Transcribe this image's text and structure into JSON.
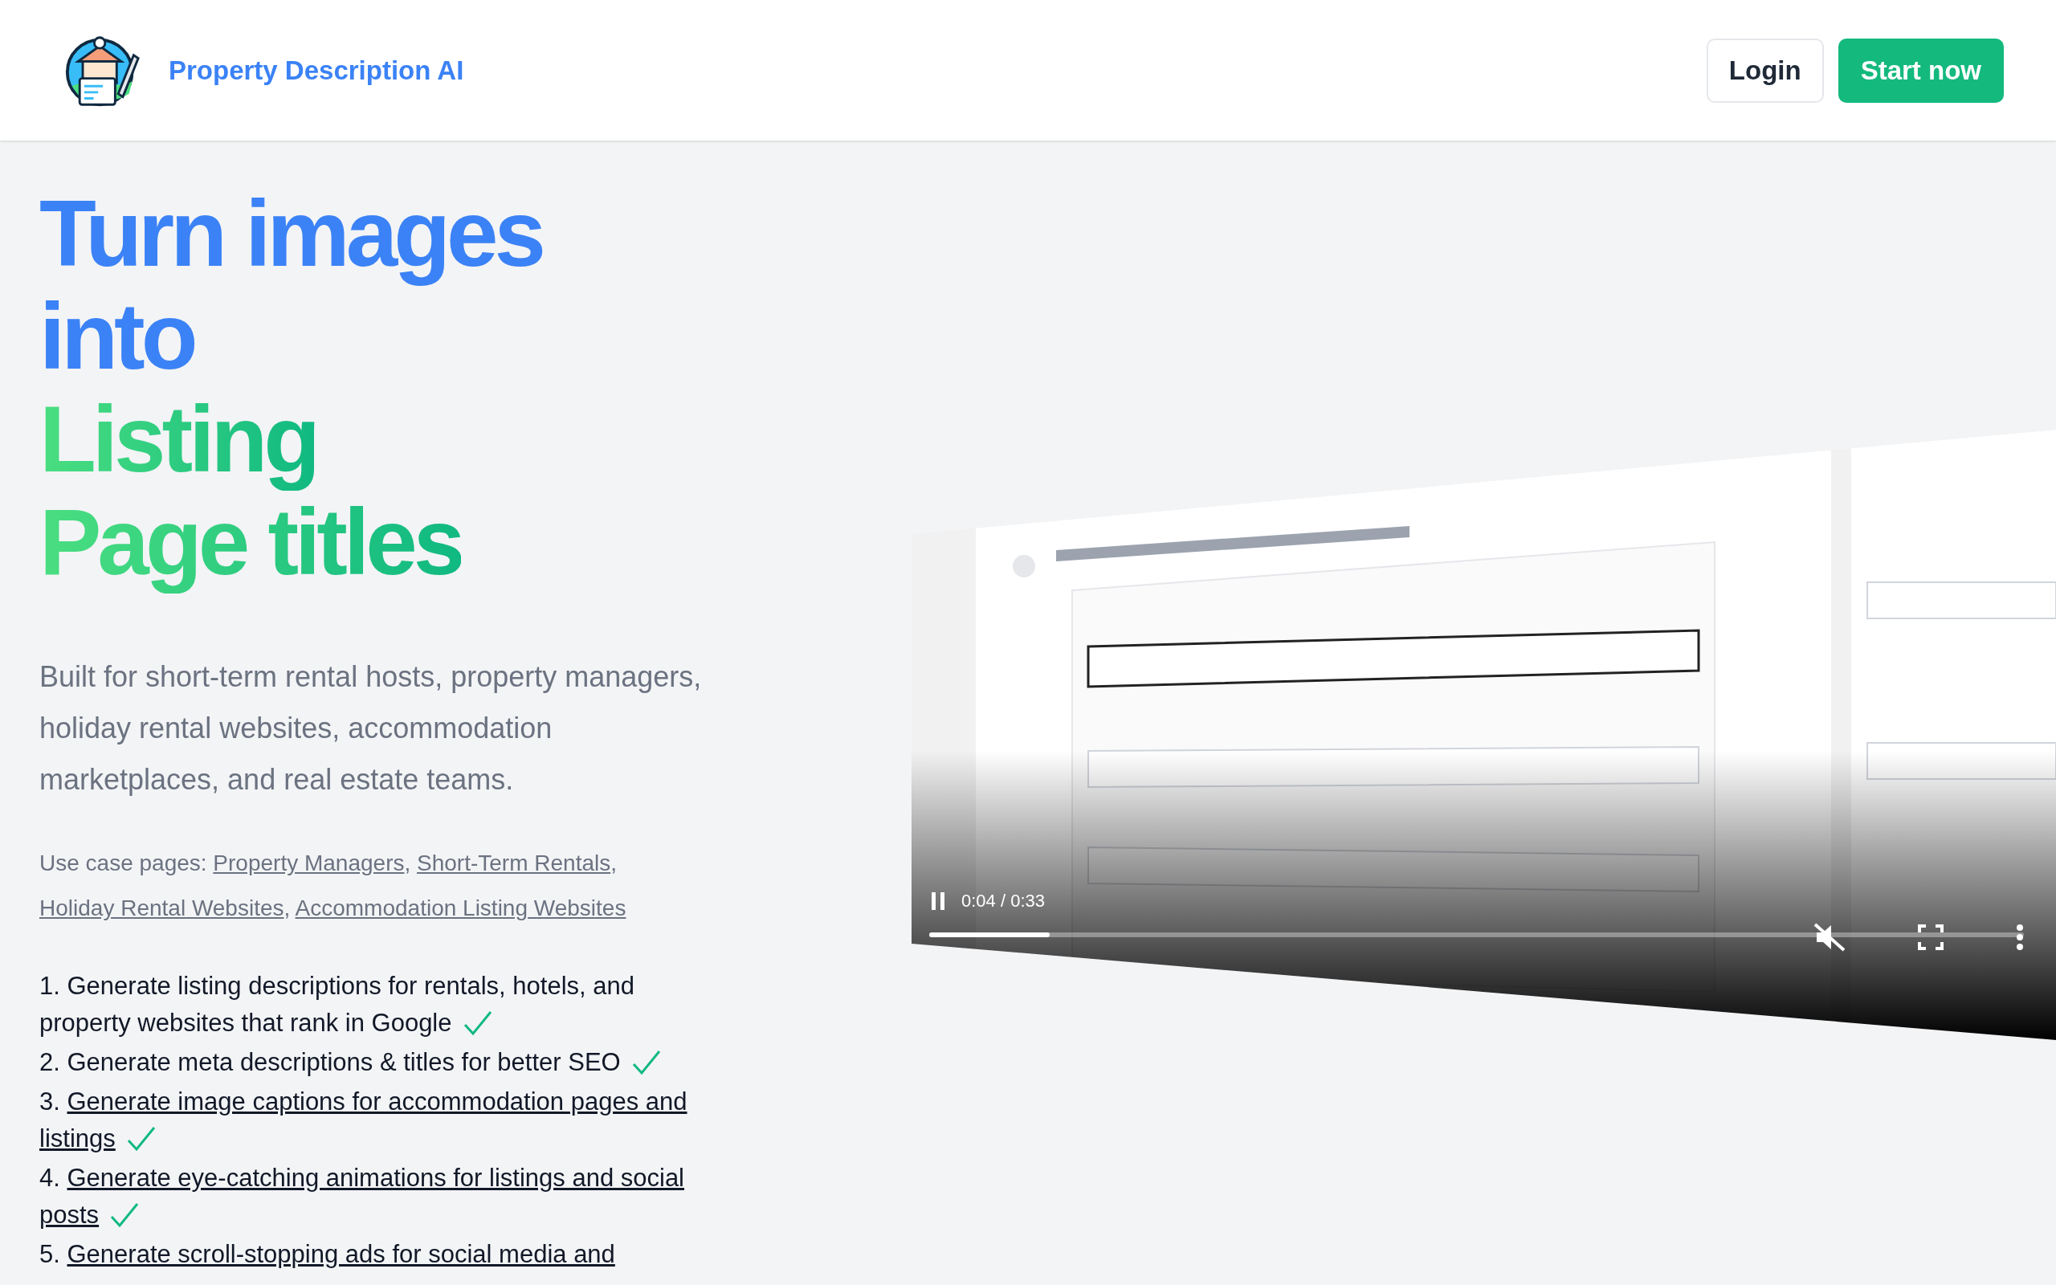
{
  "header": {
    "brand": "Property Description AI",
    "buttons": [
      {
        "label": "Login",
        "kind": "outline"
      },
      {
        "label": "Start now",
        "kind": "primary"
      }
    ]
  },
  "hero": {
    "title_lines": [
      {
        "text": "Turn images",
        "kind": "blue"
      },
      {
        "text": "into",
        "kind": "blue"
      },
      {
        "text": "Listing",
        "kind": "green"
      },
      {
        "text": "Page titles",
        "kind": "green"
      }
    ],
    "intro": "Built for short-term rental hosts, property managers, holiday rental websites, accommodation marketplaces, and real estate teams.",
    "use_cases": {
      "label": "Use case pages:",
      "separator": ",",
      "links": [
        "Property Managers",
        "Short-Term Rentals",
        "Holiday Rental Websites",
        "Accommodation Listing Websites"
      ]
    },
    "features": [
      {
        "number": "1.",
        "text": "Generate listing descriptions for rentals, hotels, and property websites that rank in Google",
        "kind": "plain",
        "checked": true
      },
      {
        "number": "2.",
        "text": "Generate meta descriptions & titles for better SEO",
        "kind": "plain",
        "checked": true
      },
      {
        "number": "3.",
        "text": "Generate image captions for accommodation pages and listings",
        "kind": "link",
        "checked": true
      },
      {
        "number": "4.",
        "text": "Generate eye-catching animations for listings and social posts",
        "kind": "link",
        "checked": true
      },
      {
        "number": "5.",
        "text": "Generate scroll-stopping ads for social media and",
        "kind": "link",
        "checked": false
      }
    ]
  },
  "video": {
    "kind": "picture",
    "time": "0:04 / 0:33",
    "level": 0.11,
    "playing": true,
    "muted": true
  }
}
